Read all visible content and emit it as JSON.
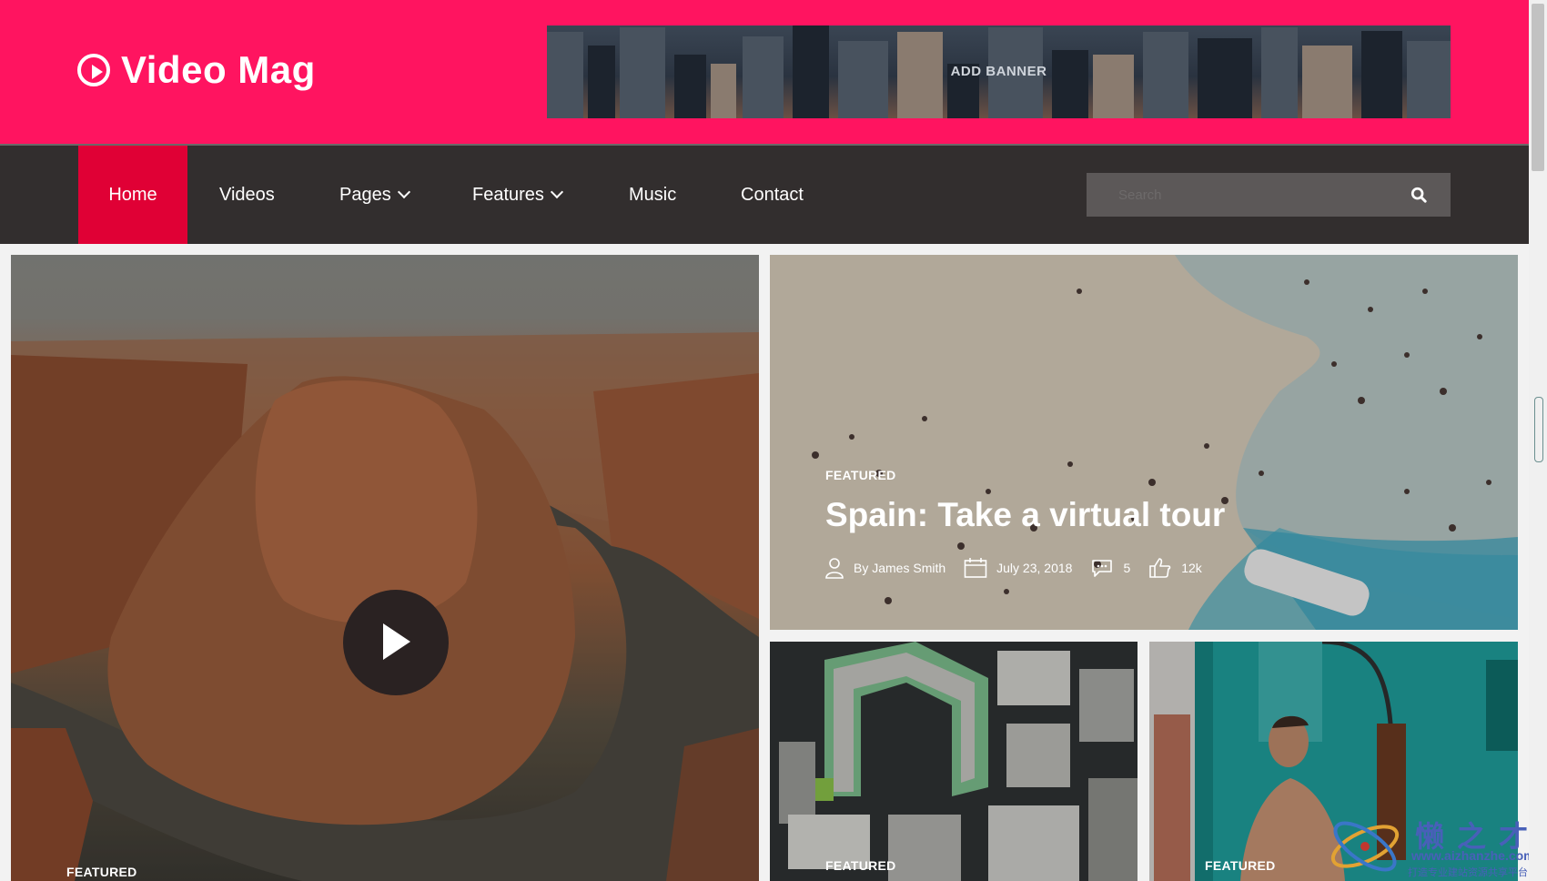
{
  "header": {
    "logo_text": "Video Mag",
    "banner_text": "ADD BANNER"
  },
  "nav": {
    "items": [
      {
        "label": "Home",
        "active": true
      },
      {
        "label": "Videos"
      },
      {
        "label": "Pages",
        "dropdown": true
      },
      {
        "label": "Features",
        "dropdown": true
      },
      {
        "label": "Music"
      },
      {
        "label": "Contact"
      }
    ],
    "search_placeholder": "Search"
  },
  "posts": {
    "main": {
      "tag": "FEATURED"
    },
    "spain": {
      "tag": "FEATURED",
      "title": "Spain: Take a virtual tour",
      "author": "By James Smith",
      "date": "July 23, 2018",
      "comments": "5",
      "likes": "12k"
    },
    "city": {
      "tag": "FEATURED"
    },
    "shower": {
      "tag": "FEATURED"
    }
  },
  "watermark": {
    "cn": "懒之才",
    "url": "www.aizhanzhe.com",
    "sub": "打造专业建站资源共享平台"
  },
  "colors": {
    "brand_pink": "#ff1460",
    "nav_active": "#e00035",
    "nav_bg": "#322e2e"
  }
}
